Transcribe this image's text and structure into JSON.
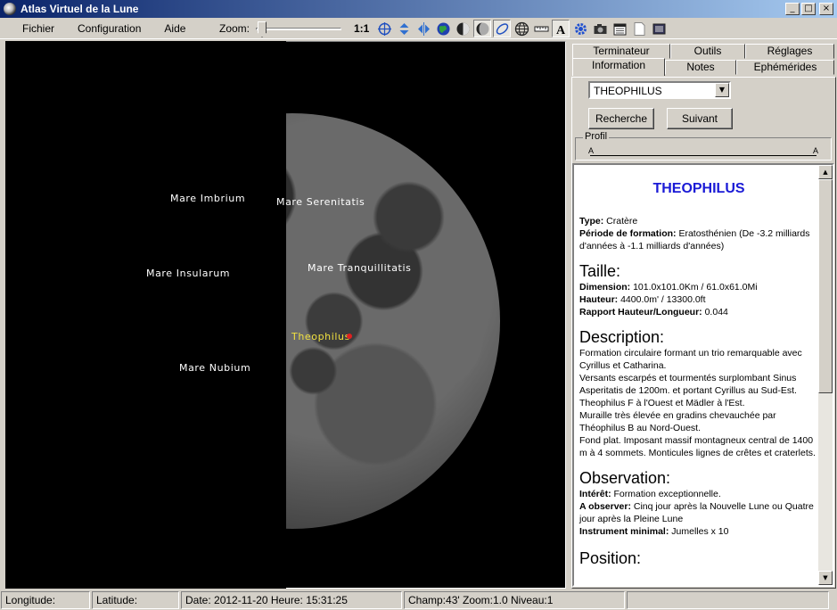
{
  "window": {
    "title": "Atlas Virtuel de la Lune",
    "buttons": [
      "_",
      "□",
      "×"
    ]
  },
  "menu": {
    "items": [
      "Fichier",
      "Configuration",
      "Aide"
    ]
  },
  "zoom": {
    "label": "Zoom:",
    "value": "1:1",
    "slider_fraction": 0.0
  },
  "toolbar": {
    "icons": [
      "crosshair-icon",
      "flip-vertical-icon",
      "flip-horizontal-icon",
      "earth-icon",
      "moon-phase-icon",
      "ellipse-icon",
      "globe-grid-icon",
      "ruler-icon",
      "text-label-icon",
      "gear-icon",
      "camera-icon",
      "calendar-icon",
      "document-icon",
      "window-icon"
    ]
  },
  "map": {
    "labels": [
      {
        "text": "Mare Imbrium",
        "selected": false
      },
      {
        "text": "Mare Serenitatis",
        "selected": false
      },
      {
        "text": "Mare Insularum",
        "selected": false
      },
      {
        "text": "Mare Tranquillitatis",
        "selected": false
      },
      {
        "text": "Theophilus",
        "selected": true
      },
      {
        "text": "Mare Nubium",
        "selected": false
      }
    ]
  },
  "tabs": {
    "top": [
      "Terminateur",
      "Outils",
      "Réglages"
    ],
    "bottom": [
      "Information",
      "Notes",
      "Ephémérides"
    ],
    "active": "Information"
  },
  "search": {
    "selected": "THEOPHILUS",
    "search_label": "Recherche",
    "next_label": "Suivant",
    "profil_label": "Profil",
    "profil_marker": "A"
  },
  "info": {
    "title": "THEOPHILUS",
    "type_label": "Type:",
    "type_value": "Cratère",
    "period_label": "Période de formation:",
    "period_value": "Eratosthénien (De -3.2 milliards d'années à -1.1 milliards d'années)",
    "taille_heading": "Taille:",
    "dimension_label": "Dimension:",
    "dimension_value": "101.0x101.0Km / 61.0x61.0Mi",
    "hauteur_label": "Hauteur:",
    "hauteur_value": "4400.0m' / 13300.0ft",
    "rapport_label": "Rapport Hauteur/Longueur:",
    "rapport_value": "0.044",
    "description_heading": "Description:",
    "description_lines": [
      "Formation circulaire formant un trio remarquable avec Cyrillus et Catharina.",
      "Versants escarpés et tourmentés surplombant Sinus Asperitatis de 1200m. et portant Cyrillus au Sud-Est.",
      "Theophilus F à l'Ouest et Mädler à l'Est.",
      "Muraille très élevée en gradins chevauchée par Théophilus B au Nord-Ouest.",
      "Fond plat. Imposant massif montagneux central de 1400 m à 4 sommets. Monticules lignes de crêtes et craterlets."
    ],
    "observation_heading": "Observation:",
    "interet_label": "Intérêt:",
    "interet_value": "Formation exceptionnelle.",
    "observer_label": "A observer:",
    "observer_value": "Cinq jour après la Nouvelle Lune ou Quatre jour après la Pleine Lune",
    "instrument_label": "Instrument minimal:",
    "instrument_value": "Jumelles x 10",
    "position_heading": "Position:"
  },
  "status": {
    "longitude": "Longitude:",
    "latitude": "Latitude:",
    "datetime": "Date: 2012-11-20   Heure: 15:31:25",
    "champ": "Champ:43' Zoom:1.0  Niveau:1"
  }
}
